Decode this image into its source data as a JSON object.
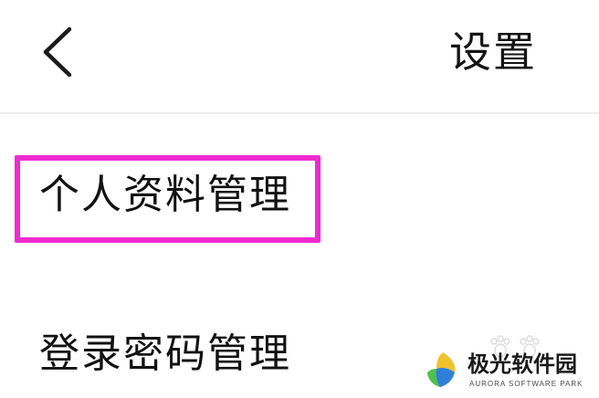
{
  "header": {
    "back_icon": "chevron-left-icon",
    "title": "设置"
  },
  "menu": {
    "items": [
      {
        "label": "个人资料管理",
        "highlighted": true
      },
      {
        "label": "登录密码管理",
        "highlighted": false
      }
    ]
  },
  "annotation": {
    "highlight_color": "#ef2bcf"
  },
  "watermark": {
    "name": "极光软件园",
    "subtitle": "AURORA SOFTWARE PARK",
    "logo_icon": "aurora-logo-icon"
  }
}
